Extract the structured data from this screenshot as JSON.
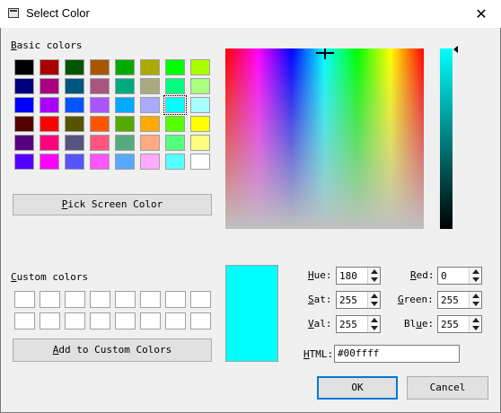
{
  "window": {
    "title": "Select Color",
    "close_glyph": "✕",
    "icon": "window-icon"
  },
  "basic": {
    "label_first": "B",
    "label_rest": "asic colors",
    "swatches": [
      [
        "#000000",
        "#aa0000",
        "#005500",
        "#aa5500",
        "#00aa00",
        "#aaaa00",
        "#00ff00",
        "#aaff00"
      ],
      [
        "#00007f",
        "#aa007f",
        "#00557f",
        "#aa557f",
        "#00aa7f",
        "#aaaa7f",
        "#00ff7f",
        "#aaff7f"
      ],
      [
        "#0000ff",
        "#aa00ff",
        "#0055ff",
        "#aa55ff",
        "#00aaff",
        "#aaaaff",
        "#00ffff",
        "#aaffff"
      ],
      [
        "#550000",
        "#ff0000",
        "#555500",
        "#ff5500",
        "#55aa00",
        "#ffaa00",
        "#55ff00",
        "#ffff00"
      ],
      [
        "#55007f",
        "#ff007f",
        "#55557f",
        "#ff557f",
        "#55aa7f",
        "#ffaa7f",
        "#55ff7f",
        "#ffff7f"
      ],
      [
        "#5500ff",
        "#ff00ff",
        "#5555ff",
        "#ff55ff",
        "#55aaff",
        "#ffaaff",
        "#55ffff",
        "#ffffff"
      ]
    ],
    "selected": "#00ffff"
  },
  "pick_button": {
    "first": "P",
    "rest": "ick Screen Color"
  },
  "custom": {
    "label_first": "C",
    "label_rest": "ustom colors"
  },
  "add_button": {
    "first": "A",
    "rest": "dd to Custom Colors"
  },
  "fields": {
    "hue": {
      "first": "H",
      "rest": "ue:",
      "value": "180"
    },
    "sat": {
      "first": "S",
      "rest": "at:",
      "value": "255"
    },
    "val": {
      "first": "V",
      "rest": "al:",
      "value": "255"
    },
    "red": {
      "first": "R",
      "rest": "ed:",
      "value": "0"
    },
    "green": {
      "first": "G",
      "rest": "reen:",
      "value": "255"
    },
    "blue": {
      "first": "",
      "pre": "Bl",
      "under": "u",
      "rest": "e:",
      "value": "255"
    },
    "html": {
      "first": "H",
      "rest": "TML:",
      "value": "#00ffff"
    }
  },
  "ok_button": {
    "label": "OK"
  },
  "cancel_button": {
    "label": "Cancel"
  },
  "preview_color": "#00ffff"
}
